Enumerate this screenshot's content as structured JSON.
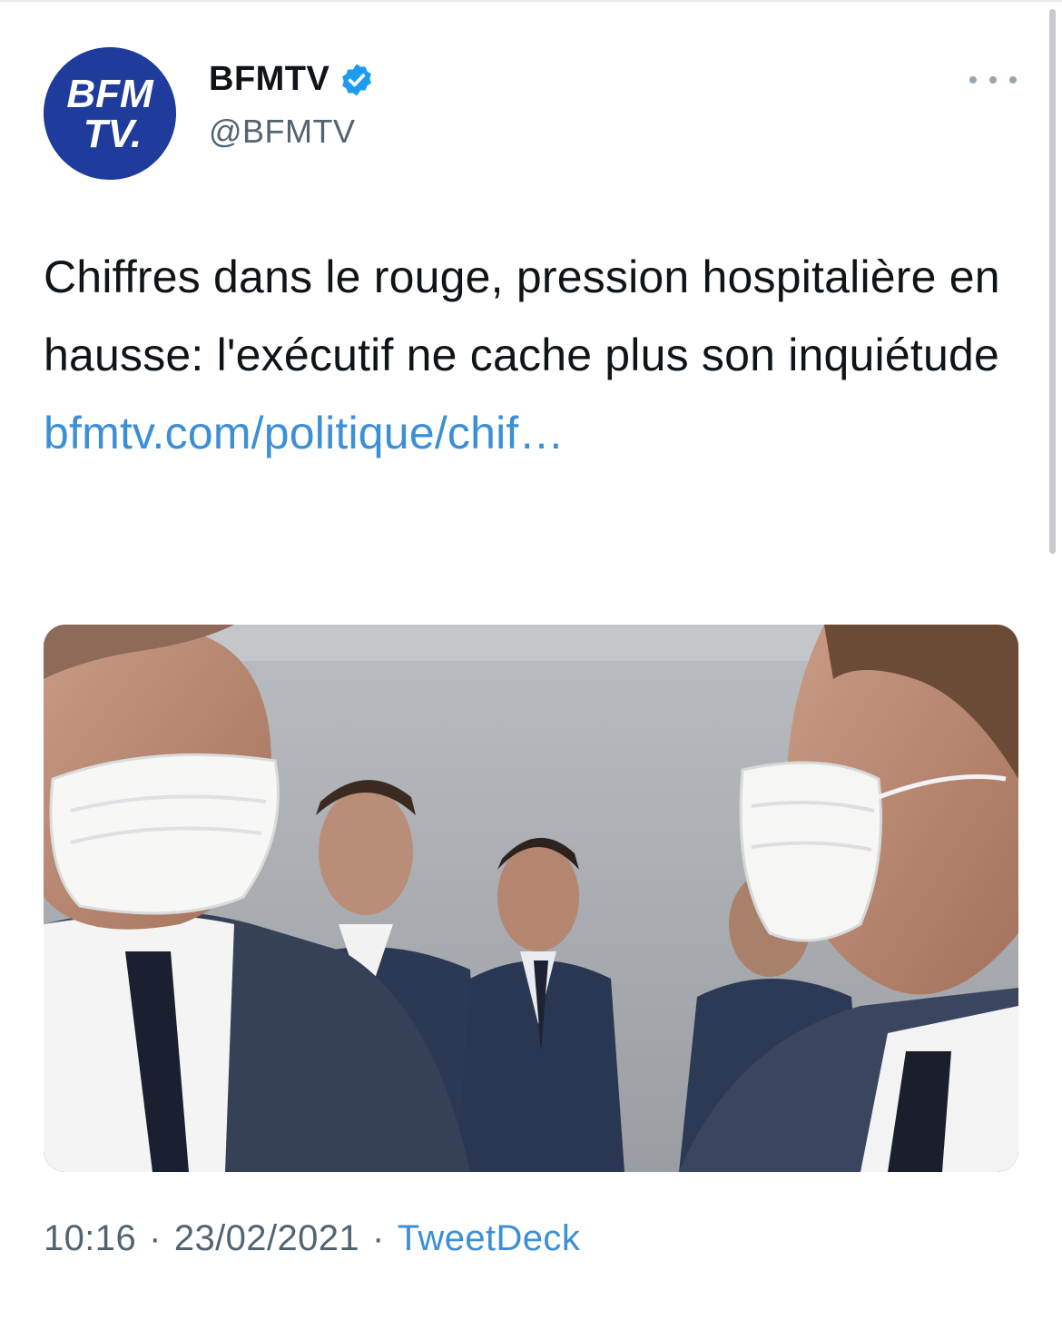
{
  "author": {
    "name": "BFMTV",
    "handle": "@BFMTV",
    "verified_icon": "verified-badge-icon",
    "avatar_logo_lines": [
      "BFM",
      "TV."
    ]
  },
  "tweet": {
    "text": "Chiffres dans le rouge, pression hospitalière en hausse: l'exécutif ne cache plus son inquiétude ",
    "link_text": "bfmtv.com/politique/chif…"
  },
  "meta": {
    "time": "10:16",
    "separator": "·",
    "date": "23/02/2021",
    "source": "TweetDeck"
  },
  "icons": {
    "more": "more-options-icon"
  },
  "colors": {
    "link": "#3c8fd6",
    "secondary_text": "#536471",
    "avatar_bg": "#1f3b9c",
    "verified": "#1d9bf0"
  }
}
